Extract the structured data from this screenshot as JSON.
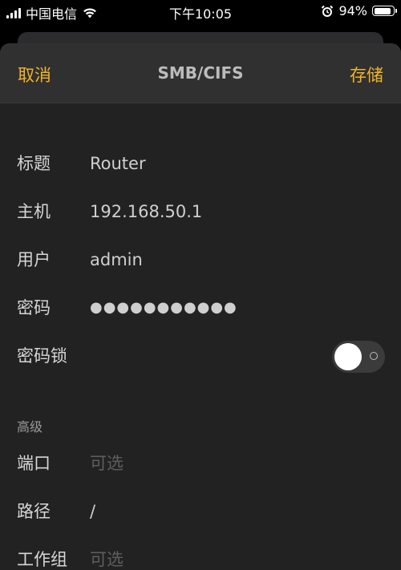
{
  "status_bar": {
    "carrier": "中国电信",
    "time": "下午10:05",
    "battery_percent": "94%",
    "battery_level": 0.94,
    "icons": [
      "signal-icon",
      "wifi-icon",
      "alarm-icon",
      "battery-icon"
    ]
  },
  "header": {
    "cancel_label": "取消",
    "title": "SMB/CIFS",
    "save_label": "存储"
  },
  "form": {
    "title_label": "标题",
    "title_value": "Router",
    "host_label": "主机",
    "host_value": "192.168.50.1",
    "user_label": "用户",
    "user_value": "admin",
    "password_label": "密码",
    "password_value": "●●●●●●●●●●●",
    "lock_label": "密码锁",
    "lock_enabled": false
  },
  "advanced": {
    "section_label": "高级",
    "port_label": "端口",
    "port_placeholder": "可选",
    "path_label": "路径",
    "path_value": "/",
    "workgroup_label": "工作组",
    "workgroup_placeholder": "可选"
  },
  "colors": {
    "accent": "#f0b429",
    "background": "#222222",
    "header_background": "#303030"
  }
}
